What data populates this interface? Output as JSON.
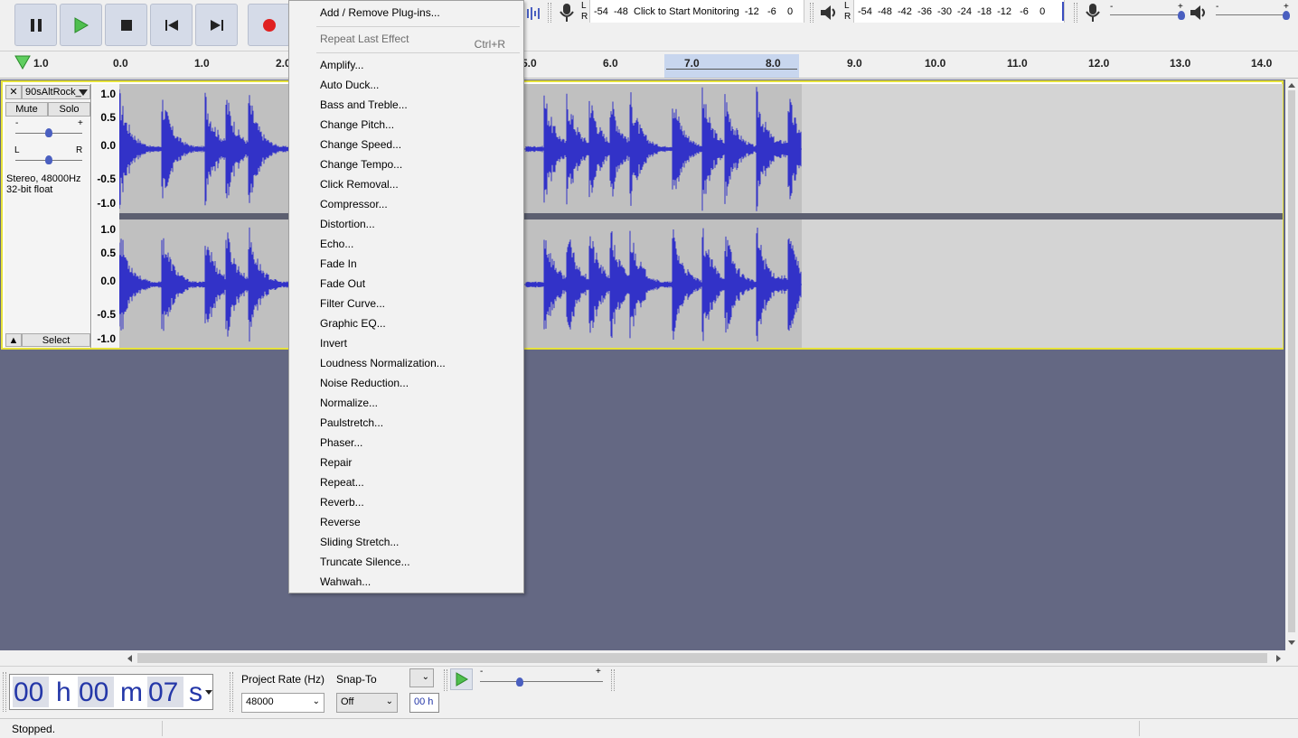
{
  "toolbar": {
    "pause_label": "Pause",
    "play_label": "Play",
    "stop_label": "Stop",
    "skip_start_label": "Skip to Start",
    "skip_end_label": "Skip to End",
    "record_label": "Record",
    "record_meter_l": "L",
    "record_meter_r": "R",
    "record_meter_scale": "-54  -48  Click to Start Monitoring  -12   -6    0",
    "play_meter_l": "L",
    "play_meter_r": "R",
    "play_meter_scale": "-54  -48  -42  -36  -30  -24  -18  -12   -6    0",
    "record_volume_minus": "-",
    "record_volume_plus": "+",
    "play_volume_minus": "-",
    "play_volume_plus": "+",
    "play_cursor_position": 0.99
  },
  "ruler": {
    "left_label": "1.0",
    "ticks": [
      "0.0",
      "1.0",
      "2.0",
      "5.0",
      "6.0",
      "7.0",
      "8.0",
      "9.0",
      "10.0",
      "11.0",
      "12.0",
      "13.0",
      "14.0"
    ]
  },
  "track": {
    "name": "90sAltRock_",
    "close": "✕",
    "mute": "Mute",
    "solo": "Solo",
    "gain_minus": "-",
    "gain_plus": "+",
    "pan_l": "L",
    "pan_r": "R",
    "info_line1": "Stereo, 48000Hz",
    "info_line2": "32-bit float",
    "collapse": "▲",
    "select": "Select",
    "scale_top": [
      "1.0",
      "0.5",
      "0.0",
      "-0.5",
      "-1.0"
    ],
    "scale_bottom": [
      "1.0",
      "0.5",
      "0.0",
      "-0.5",
      "-1.0"
    ]
  },
  "menu": {
    "add_remove": "Add / Remove Plug-ins...",
    "repeat_last": "Repeat Last Effect",
    "repeat_shortcut": "Ctrl+R",
    "items": [
      "Amplify...",
      "Auto Duck...",
      "Bass and Treble...",
      "Change Pitch...",
      "Change Speed...",
      "Change Tempo...",
      "Click Removal...",
      "Compressor...",
      "Distortion...",
      "Echo...",
      "Fade In",
      "Fade Out",
      "Filter Curve...",
      "Graphic EQ...",
      "Invert",
      "Loudness Normalization...",
      "Noise Reduction...",
      "Normalize...",
      "Paulstretch...",
      "Phaser...",
      "Repair",
      "Repeat...",
      "Reverb...",
      "Reverse",
      "Sliding Stretch...",
      "Truncate Silence...",
      "Wahwah..."
    ]
  },
  "selection": {
    "time": {
      "h": "00",
      "h_unit": "h",
      "m": "00",
      "m_unit": "m",
      "s": "07",
      "s_unit": "s"
    },
    "project_rate_label": "Project Rate (Hz)",
    "project_rate_value": "48000",
    "snap_to_label": "Snap-To",
    "snap_to_value": "Off",
    "small_time": "00 h",
    "play_speed_minus": "-",
    "play_speed_plus": "+"
  },
  "status": {
    "text": "Stopped."
  },
  "colors": {
    "waveform": "#3232c8",
    "selection_bg": "#c0c0c0",
    "track_border": "#e6e23a",
    "background": "#646883",
    "time_digits": "#2437a8"
  }
}
